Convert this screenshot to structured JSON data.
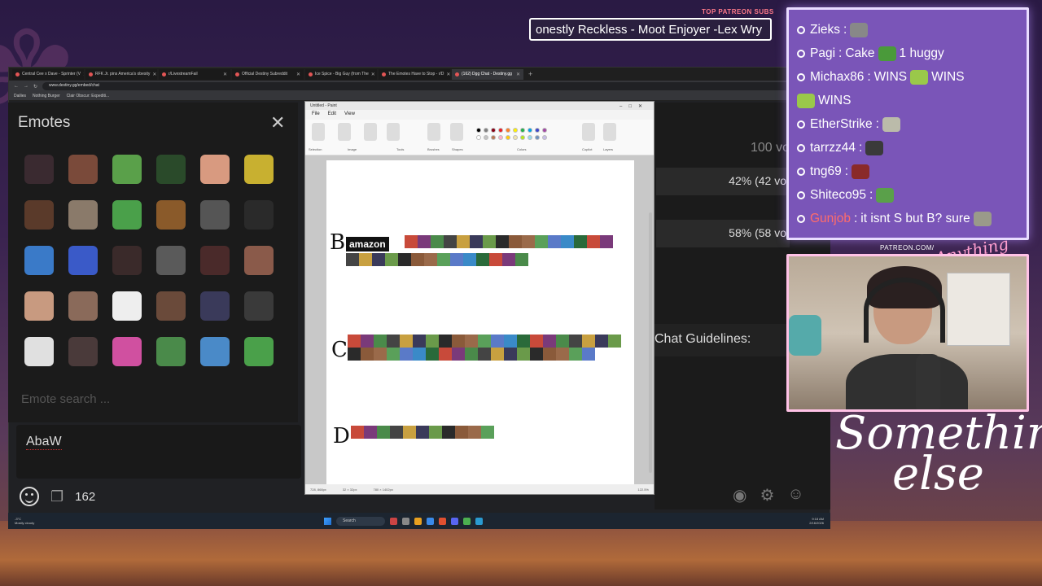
{
  "overlay": {
    "top_subs_label": "TOP PATREON SUBS",
    "ticker_text": "onestly Reckless - Moot Enjoyer -Lex Wry",
    "patreon_url": "PATREON.COM/",
    "anything_else_logo": "Anything else",
    "something_else_logo_line1": "Something",
    "something_else_logo_line2": "else"
  },
  "browser": {
    "tabs": [
      {
        "label": "Central Cee x Dave - Sprinter (V",
        "active": false
      },
      {
        "label": "RFK Jr. pins America's obesity",
        "active": false
      },
      {
        "label": "r/LivestreamFail",
        "active": false
      },
      {
        "label": "Official Destiny Subreddit",
        "active": false
      },
      {
        "label": "Ice Spice - Big Guy (from The",
        "active": false
      },
      {
        "label": "The Emotes Have to Stop - r/D",
        "active": false
      },
      {
        "label": "(162) Dgg Chat - Destiny.gg",
        "active": true
      }
    ],
    "url": "www.destiny.gg/embed/chat",
    "zoom": "300%",
    "bookmarks": [
      "Dailies",
      "Nothing Burger",
      "Clair Obscur: Expediti..."
    ]
  },
  "emotes_panel": {
    "title": "Emotes",
    "close_icon": "close-icon",
    "search_placeholder": "Emote search ...",
    "emote_colors": [
      "#3a2a30",
      "#7a4a3a",
      "#5aa04a",
      "#2a4a2a",
      "#d89a80",
      "#c8b030",
      "#5a3a2a",
      "#8a7a6a",
      "#4aa04a",
      "#8a5a2a",
      "#555555",
      "#2a2a2a",
      "#3a7ac8",
      "#3a5ac8",
      "#3a2a2a",
      "#5a5a5a",
      "#4a2a2a",
      "#8a5a4a",
      "#c89a80",
      "#8a6a5a",
      "#eeeeee",
      "#6a4a3a",
      "#3a3a5a",
      "#3a3a3a",
      "#e0e0e0",
      "#4a3a3a",
      "#d050a0",
      "#4a8a4a",
      "#4a8ac8",
      "#4aa04a"
    ]
  },
  "chat_input": {
    "value": "AbaW",
    "user_count": "162"
  },
  "right_page": {
    "votes_total": "100 vo",
    "vote_option_a": "42% (42 vo",
    "vote_option_b": "58% (58 vo",
    "guidelines": "Chat Guidelines:"
  },
  "paint": {
    "title": "Untitled - Paint",
    "menu": [
      "File",
      "Edit",
      "View"
    ],
    "ribbon_labels": [
      "Selection",
      "Image",
      "Tools",
      "Brushes",
      "Shapes",
      "Colors",
      "Copilot",
      "Layers"
    ],
    "palette": [
      "#000000",
      "#7f7f7f",
      "#880015",
      "#ed1c24",
      "#ff7f27",
      "#fff200",
      "#22b14c",
      "#00a2e8",
      "#3f48cc",
      "#a349a4",
      "#ffffff",
      "#c3c3c3",
      "#b97a57",
      "#ffaec9",
      "#ffc90e",
      "#efe4b0",
      "#b5e61d",
      "#99d9ea",
      "#7092be",
      "#c8bfe7"
    ],
    "tiers": [
      {
        "letter": "B",
        "label": "amazon"
      },
      {
        "letter": "C",
        "label": ""
      },
      {
        "letter": "D",
        "label": ""
      }
    ],
    "status_cursor": "728, 868px",
    "status_selection": "32 × 32px",
    "status_size": "780 × 1402px",
    "status_zoom": "122.5%"
  },
  "taskbar": {
    "weather_temp": "-3°C",
    "weather_desc": "Mostly cloudy",
    "search_label": "Search",
    "time": "9:18 AM",
    "date": "2/16/2026"
  },
  "stream_chat": [
    {
      "user": "Zieks",
      "msg": "",
      "emote": "#888888",
      "bullet": "#7a55b8"
    },
    {
      "user": "Pagi",
      "msg": "Cake",
      "msg2": "1 huggy",
      "emote": "#4a9a3a",
      "bullet": "#7a55b8"
    },
    {
      "user": "Michax86",
      "msg": "WINS",
      "msg2": "WINS",
      "msg3": "WINS",
      "emote": "#9ac84a",
      "bullet": "#7a55b8"
    },
    {
      "user": "EtherStrike",
      "msg": "",
      "emote": "#bbbbaa",
      "bullet": "#7a55b8"
    },
    {
      "user": "tarrzz44",
      "msg": "",
      "emote": "#3a3a3a",
      "bullet": "#7a55b8"
    },
    {
      "user": "tng69",
      "msg": "",
      "emote": "#8a2a2a",
      "bullet": "#7a55b8"
    },
    {
      "user": "Shiteco95",
      "msg": "",
      "emote": "#5aa04a",
      "bullet": "#7a55b8"
    },
    {
      "user": "Gunjob",
      "msg": "it isnt S but B? sure",
      "emote": "#9a9a8a",
      "bullet": "#7a55b8",
      "red": true
    }
  ]
}
